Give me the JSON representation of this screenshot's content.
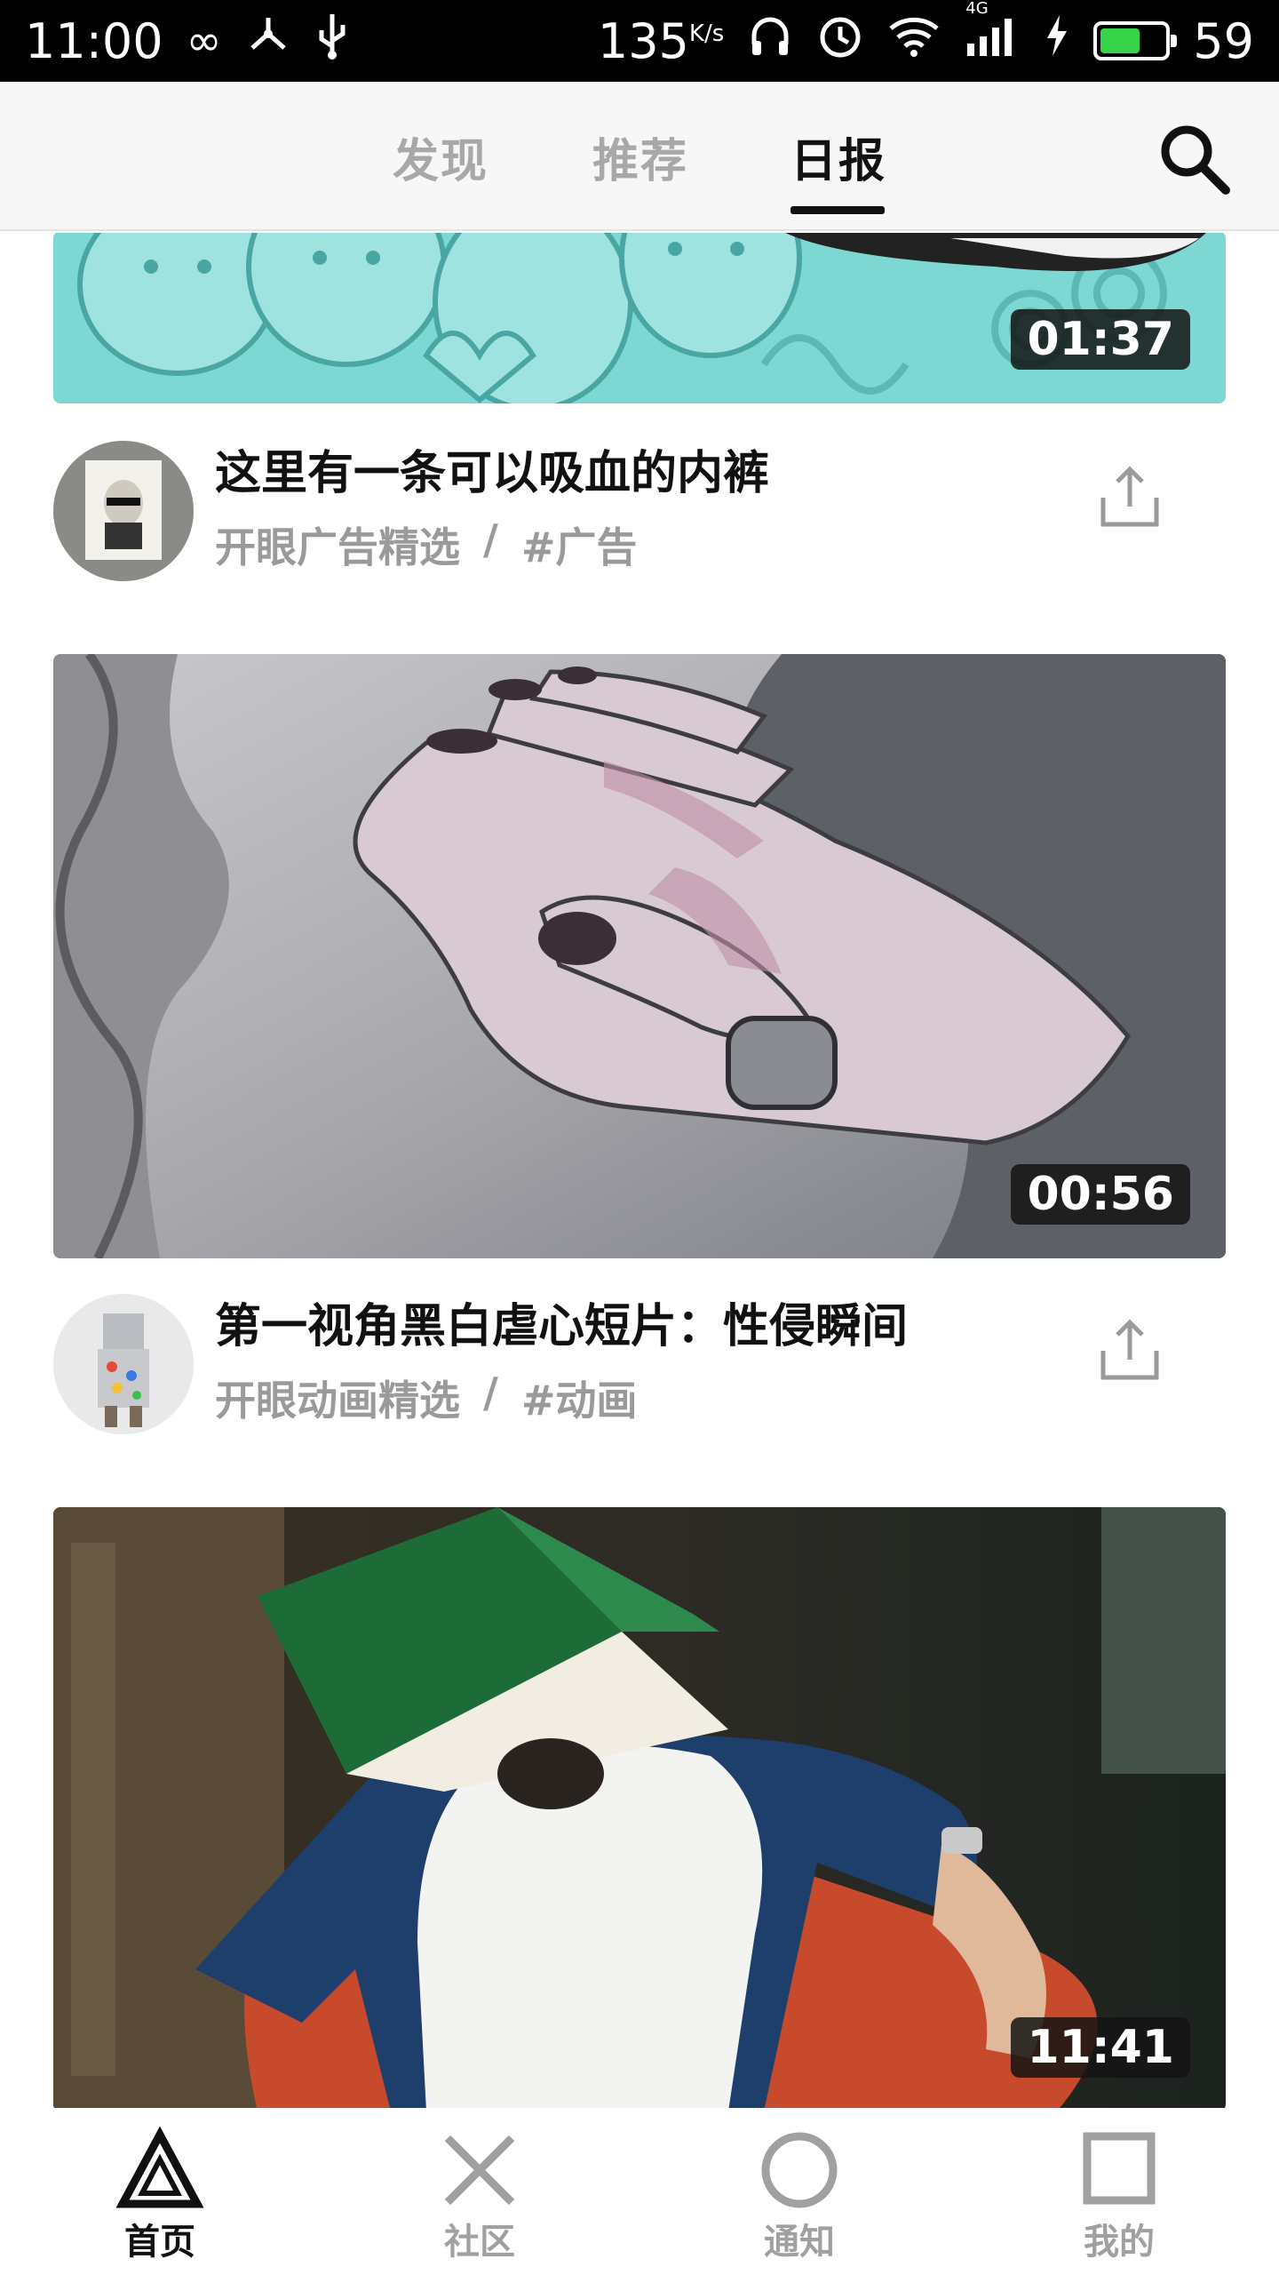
{
  "status_bar": {
    "time": "11:00",
    "infinity_glyph": "∞",
    "speed": "135",
    "speed_unit": "K/s",
    "network": "4G",
    "battery": "59"
  },
  "top_nav": {
    "tabs": [
      {
        "label": "发现"
      },
      {
        "label": "推荐"
      },
      {
        "label": "日报"
      }
    ],
    "active_tab": "日报",
    "search_icon": "search-icon"
  },
  "feed": {
    "cards": [
      {
        "duration": "01:37",
        "title": "这里有一条可以吸血的内裤",
        "category": "开眼广告精选",
        "separator": "/",
        "tag": "#广告"
      },
      {
        "duration": "00:56",
        "title": "第一视角黑白虐心短片：性侵瞬间",
        "category": "开眼动画精选",
        "separator": "/",
        "tag": "#动画"
      },
      {
        "duration": "11:41"
      }
    ]
  },
  "bottom_nav": {
    "items": [
      {
        "label": "首页",
        "icon": "triangle-icon"
      },
      {
        "label": "社区",
        "icon": "cross-icon"
      },
      {
        "label": "通知",
        "icon": "circle-icon"
      },
      {
        "label": "我的",
        "icon": "square-icon"
      }
    ],
    "active": "首页"
  },
  "colors": {
    "accent": "#111111",
    "inactive": "#a8a8a8",
    "battery": "#37d449"
  }
}
